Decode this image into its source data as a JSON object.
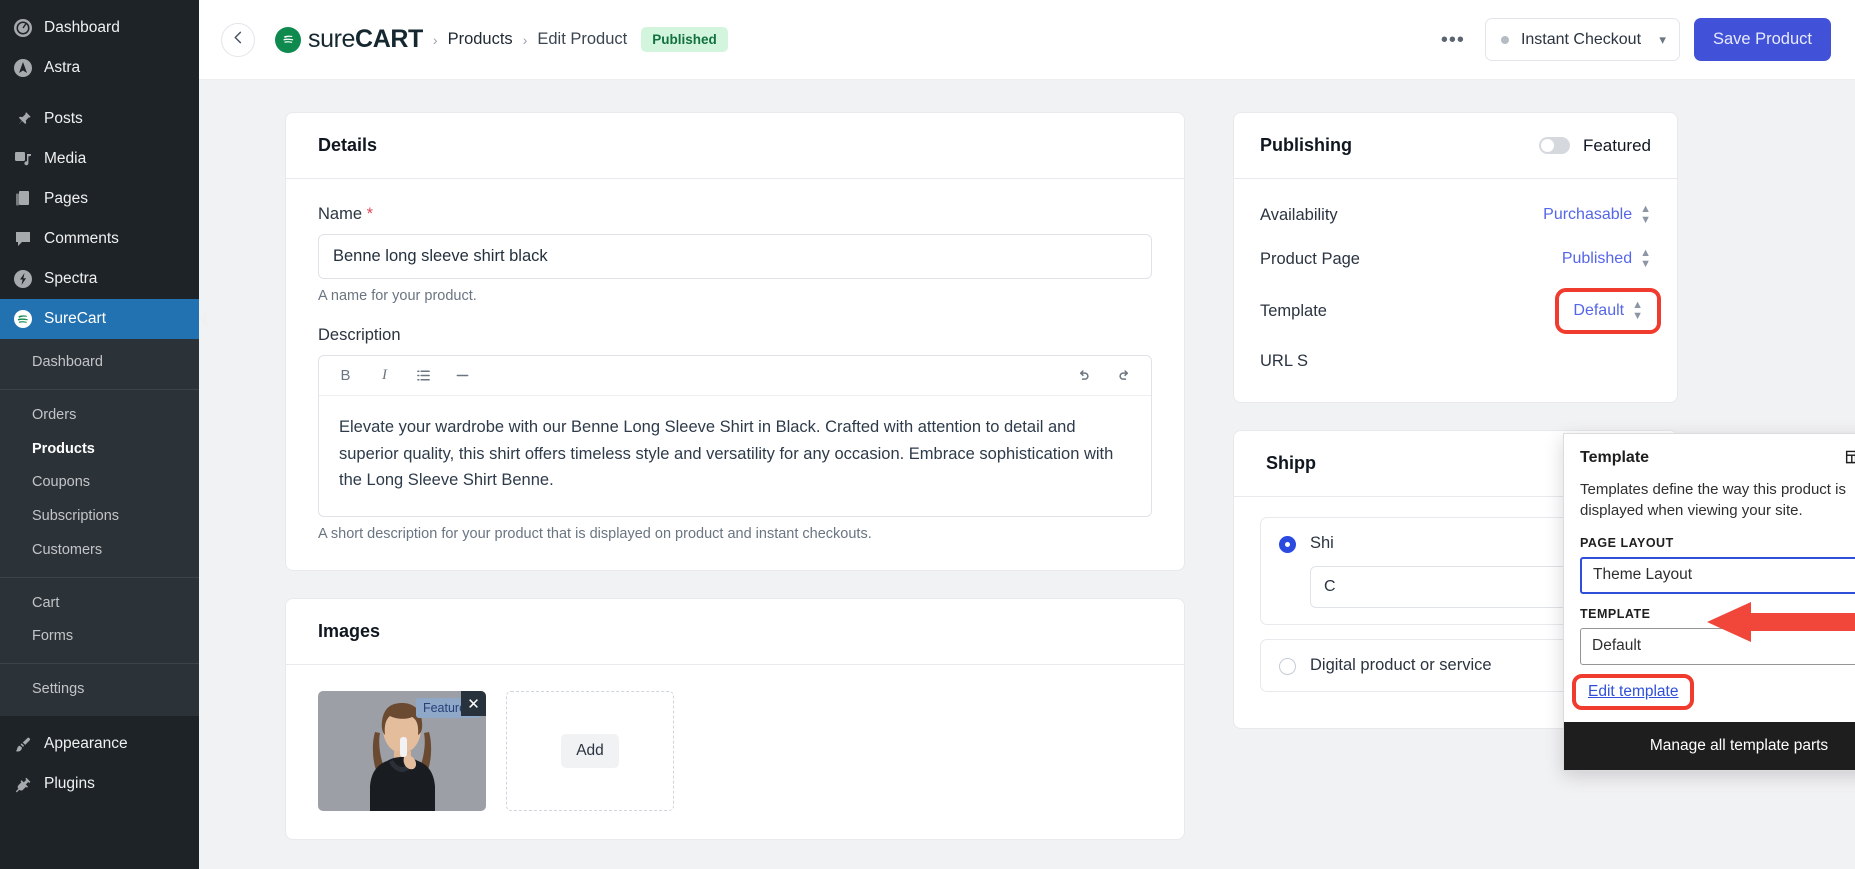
{
  "sidebar": {
    "top_items": [
      {
        "label": "Dashboard",
        "icon": "dashboard-icon"
      },
      {
        "label": "Astra",
        "icon": "astra-icon"
      }
    ],
    "main_items": [
      {
        "label": "Posts",
        "icon": "pin-icon"
      },
      {
        "label": "Media",
        "icon": "media-icon"
      },
      {
        "label": "Pages",
        "icon": "pages-icon"
      },
      {
        "label": "Comments",
        "icon": "comment-icon"
      },
      {
        "label": "Spectra",
        "icon": "spectra-icon"
      }
    ],
    "active_item": {
      "label": "SureCart",
      "icon": "surecart-icon"
    },
    "submenu_groups": [
      {
        "items": [
          {
            "label": "Dashboard",
            "active": false
          }
        ]
      },
      {
        "items": [
          {
            "label": "Orders",
            "active": false
          },
          {
            "label": "Products",
            "active": true
          },
          {
            "label": "Coupons",
            "active": false
          },
          {
            "label": "Subscriptions",
            "active": false
          },
          {
            "label": "Customers",
            "active": false
          }
        ]
      },
      {
        "items": [
          {
            "label": "Cart",
            "active": false
          },
          {
            "label": "Forms",
            "active": false
          }
        ]
      },
      {
        "items": [
          {
            "label": "Settings",
            "active": false
          }
        ]
      }
    ],
    "bottom_items": [
      {
        "label": "Appearance",
        "icon": "brush-icon"
      },
      {
        "label": "Plugins",
        "icon": "plug-icon"
      }
    ]
  },
  "topbar": {
    "back_icon": "arrow-left-icon",
    "brand_prefix": "sure",
    "brand_suffix": "CART",
    "separator": "›",
    "breadcrumb_products": "Products",
    "breadcrumb_current": "Edit Product",
    "status_pill": "Published",
    "more_dots": "•••",
    "mode_select": "Instant Checkout",
    "chevron": "⌄",
    "save_label": "Save Product"
  },
  "details": {
    "card_title": "Details",
    "name_label": "Name",
    "name_required": "*",
    "name_value": "Benne long sleeve shirt black",
    "name_help": "A name for your product.",
    "description_label": "Description",
    "toolbar": [
      "bold-icon",
      "italic-icon",
      "list-icon",
      "hr-icon",
      "undo-icon",
      "redo-icon"
    ],
    "description_value": "Elevate your wardrobe with our Benne Long Sleeve Shirt in Black. Crafted with attention to detail and superior quality, this shirt offers timeless style and versatility for any occasion. Embrace sophistication with the Long Sleeve Shirt Benne.",
    "description_help": "A short description for your product that is displayed on product and instant checkouts."
  },
  "images": {
    "card_title": "Images",
    "featured_badge": "Featured",
    "remove_icon": "close-icon",
    "add_label": "Add"
  },
  "publishing": {
    "card_title": "Publishing",
    "featured_toggle_label": "Featured",
    "rows": [
      {
        "key": "Availability",
        "value": "Purchasable",
        "highlighted": false
      },
      {
        "key": "Product Page",
        "value": "Published",
        "highlighted": false
      },
      {
        "key": "Template",
        "value": "Default",
        "highlighted": true
      }
    ],
    "url_slug_label": "URL S"
  },
  "shipping": {
    "card_title": "Shipp",
    "option_physical": "Shi",
    "option_physical_sub": "C",
    "option_digital": "Digital product or service",
    "chevron": "›"
  },
  "template_popover": {
    "title": "Template",
    "new_icon": "add-template-icon",
    "close_icon": "close-icon",
    "description": "Templates define the way this product is displayed when viewing your site.",
    "page_layout_label": "PAGE LAYOUT",
    "page_layout_value": "Theme Layout",
    "template_label": "TEMPLATE",
    "template_value": "Default",
    "edit_link": "Edit template",
    "footer_label": "Manage all template parts"
  },
  "colors": {
    "accent_blue": "#2271b1",
    "save_button": "#4152d8",
    "link_blue": "#5566e8",
    "highlight_red": "#f03c2e",
    "published_green": "#12713e",
    "brand_green": "#0e8a4f"
  }
}
